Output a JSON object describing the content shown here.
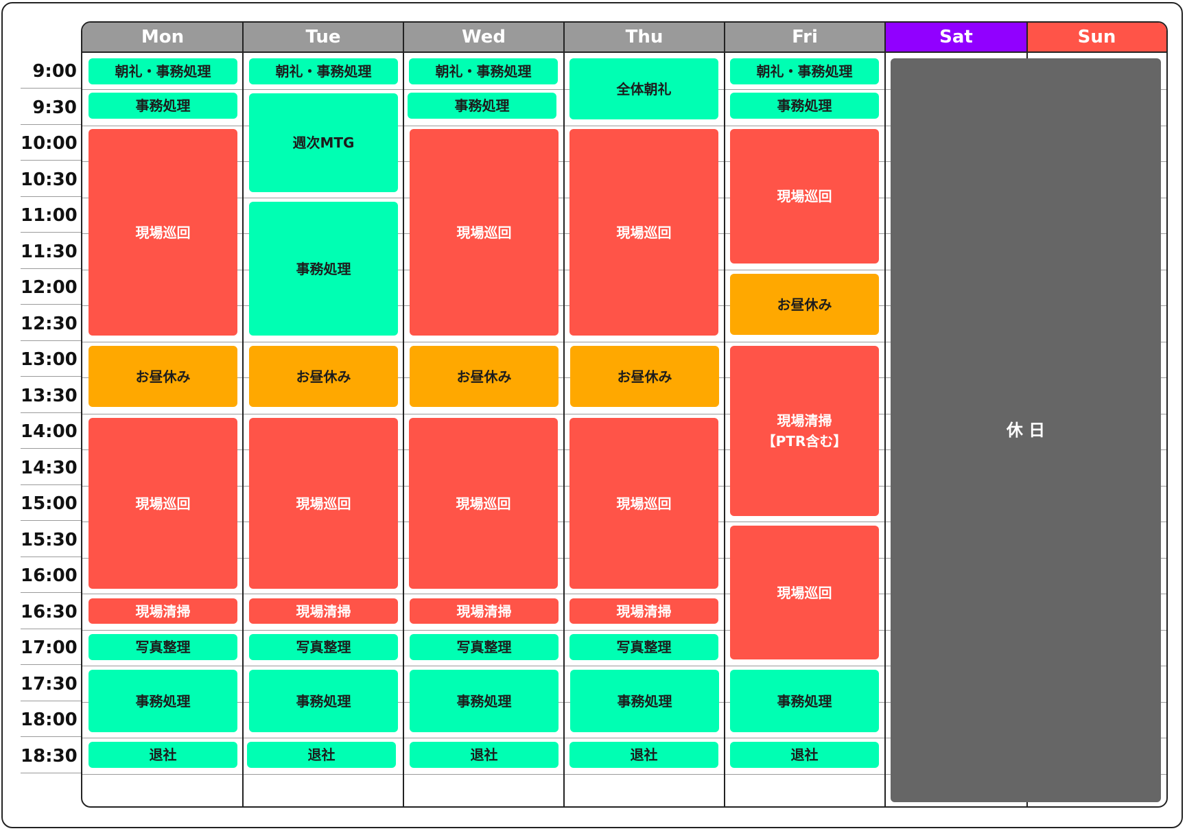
{
  "colors": {
    "weekday_header": "#9a9a9a",
    "saturday_header": "#9100ff",
    "sunday_header": "#ff5448",
    "office_event": "#00ffb3",
    "site_event": "#ff5448",
    "lunch_event": "#ffa800",
    "holiday_event": "#666666"
  },
  "days": [
    "Mon",
    "Tue",
    "Wed",
    "Thu",
    "Fri",
    "Sat",
    "Sun"
  ],
  "times": [
    "9:00",
    "9:30",
    "10:00",
    "10:30",
    "11:00",
    "11:30",
    "12:00",
    "12:30",
    "13:00",
    "13:30",
    "14:00",
    "14:30",
    "15:00",
    "15:30",
    "16:00",
    "16:30",
    "17:00",
    "17:30",
    "18:00",
    "18:30"
  ],
  "events": {
    "mon": [
      {
        "label": "朝礼・事務処理",
        "type": "office"
      },
      {
        "label": "事務処理",
        "type": "office"
      },
      {
        "label": "現場巡回",
        "type": "site"
      },
      {
        "label": "お昼休み",
        "type": "lunch"
      },
      {
        "label": "現場巡回",
        "type": "site"
      },
      {
        "label": "現場清掃",
        "type": "site"
      },
      {
        "label": "写真整理",
        "type": "office"
      },
      {
        "label": "事務処理",
        "type": "office"
      },
      {
        "label": "退社",
        "type": "office"
      }
    ],
    "tue": [
      {
        "label": "朝礼・事務処理",
        "type": "office"
      },
      {
        "label": "週次MTG",
        "type": "office"
      },
      {
        "label": "事務処理",
        "type": "office"
      },
      {
        "label": "お昼休み",
        "type": "lunch"
      },
      {
        "label": "現場巡回",
        "type": "site"
      },
      {
        "label": "現場清掃",
        "type": "site"
      },
      {
        "label": "写真整理",
        "type": "office"
      },
      {
        "label": "事務処理",
        "type": "office"
      },
      {
        "label": "退社",
        "type": "office"
      }
    ],
    "wed": [
      {
        "label": "朝礼・事務処理",
        "type": "office"
      },
      {
        "label": "事務処理",
        "type": "office"
      },
      {
        "label": "現場巡回",
        "type": "site"
      },
      {
        "label": "お昼休み",
        "type": "lunch"
      },
      {
        "label": "現場巡回",
        "type": "site"
      },
      {
        "label": "現場清掃",
        "type": "site"
      },
      {
        "label": "写真整理",
        "type": "office"
      },
      {
        "label": "事務処理",
        "type": "office"
      },
      {
        "label": "退社",
        "type": "office"
      }
    ],
    "thu": [
      {
        "label": "全体朝礼",
        "type": "office"
      },
      {
        "label": "現場巡回",
        "type": "site"
      },
      {
        "label": "お昼休み",
        "type": "lunch"
      },
      {
        "label": "現場巡回",
        "type": "site"
      },
      {
        "label": "現場清掃",
        "type": "site"
      },
      {
        "label": "写真整理",
        "type": "office"
      },
      {
        "label": "事務処理",
        "type": "office"
      },
      {
        "label": "退社",
        "type": "office"
      }
    ],
    "fri": [
      {
        "label": "朝礼・事務処理",
        "type": "office"
      },
      {
        "label": "事務処理",
        "type": "office"
      },
      {
        "label": "現場巡回",
        "type": "site"
      },
      {
        "label": "お昼休み",
        "type": "lunch"
      },
      {
        "label": "現場清掃\n【PTR含む】",
        "type": "site"
      },
      {
        "label": "現場巡回",
        "type": "site"
      },
      {
        "label": "事務処理",
        "type": "office"
      },
      {
        "label": "退社",
        "type": "office"
      }
    ],
    "weekend": [
      {
        "label": "休 日",
        "type": "holiday"
      }
    ]
  }
}
